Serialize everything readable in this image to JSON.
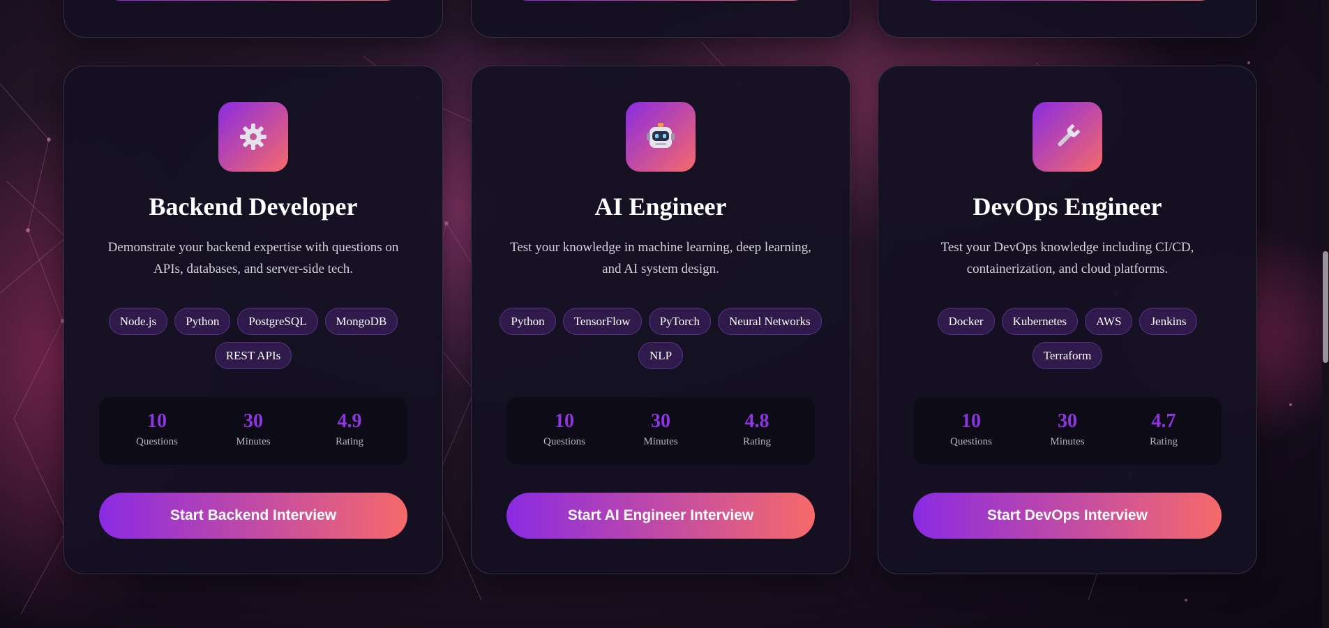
{
  "colors": {
    "accent_start": "#8a2be2",
    "accent_end": "#f66a6a",
    "stat_value": "#8e36e0",
    "card_bg": "#141122"
  },
  "cards": [
    {
      "icon": "gear-icon",
      "title": "Backend Developer",
      "description": "Demonstrate your backend expertise with questions on APIs, databases, and server-side tech.",
      "tags": [
        "Node.js",
        "Python",
        "PostgreSQL",
        "MongoDB",
        "REST APIs"
      ],
      "stats": [
        {
          "value": "10",
          "label": "Questions"
        },
        {
          "value": "30",
          "label": "Minutes"
        },
        {
          "value": "4.9",
          "label": "Rating"
        }
      ],
      "button": "Start Backend Interview"
    },
    {
      "icon": "robot-icon",
      "title": "AI Engineer",
      "description": "Test your knowledge in machine learning, deep learning, and AI system design.",
      "tags": [
        "Python",
        "TensorFlow",
        "PyTorch",
        "Neural Networks",
        "NLP"
      ],
      "stats": [
        {
          "value": "10",
          "label": "Questions"
        },
        {
          "value": "30",
          "label": "Minutes"
        },
        {
          "value": "4.8",
          "label": "Rating"
        }
      ],
      "button": "Start AI Engineer Interview"
    },
    {
      "icon": "wrench-icon",
      "title": "DevOps Engineer",
      "description": "Test your DevOps knowledge including CI/CD, containerization, and cloud platforms.",
      "tags": [
        "Docker",
        "Kubernetes",
        "AWS",
        "Jenkins",
        "Terraform"
      ],
      "stats": [
        {
          "value": "10",
          "label": "Questions"
        },
        {
          "value": "30",
          "label": "Minutes"
        },
        {
          "value": "4.7",
          "label": "Rating"
        }
      ],
      "button": "Start DevOps Interview"
    }
  ]
}
